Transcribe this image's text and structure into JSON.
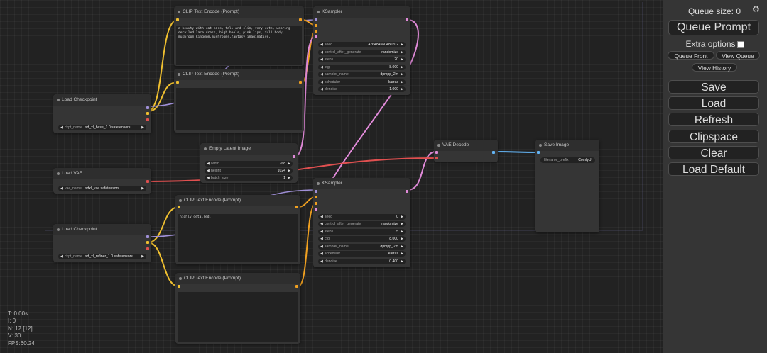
{
  "canvas": {
    "stats": [
      "T: 0.00s",
      "I: 0",
      "N: 12 [12]",
      "V: 30",
      "FPS:60.24"
    ],
    "nodes": {
      "clip1": {
        "title": "CLIP Text Encode (Prompt)",
        "text": "a beauty with cat ears, tall and slim, very cute, wearing detailed lace dress, high heels, pink lips, full body, mushroom kingdom,mushrooms,fantasy,imaginative,"
      },
      "clip2": {
        "title": "CLIP Text Encode (Prompt)",
        "text": ""
      },
      "ksampler1": {
        "title": "KSampler",
        "widgets": [
          {
            "label": "seed",
            "value": "476484560480702"
          },
          {
            "label": "control_after_generate",
            "value": "randomize"
          },
          {
            "label": "steps",
            "value": "20"
          },
          {
            "label": "cfg",
            "value": "8.000"
          },
          {
            "label": "sampler_name",
            "value": "dpmpp_2m"
          },
          {
            "label": "scheduler",
            "value": "karras"
          },
          {
            "label": "denoise",
            "value": "1.000"
          }
        ]
      },
      "ckpt1": {
        "title": "Load Checkpoint",
        "label": "ckpt_name",
        "value": "sd_xl_base_1.0.safetensors"
      },
      "latent": {
        "title": "Empty Latent Image",
        "widgets": [
          {
            "label": "width",
            "value": "768"
          },
          {
            "label": "height",
            "value": "1024"
          },
          {
            "label": "batch_size",
            "value": "1"
          }
        ]
      },
      "vaedecode": {
        "title": "VAE Decode"
      },
      "save": {
        "title": "Save Image",
        "label": "filename_prefix",
        "value": "ComfyUI"
      },
      "loadvae": {
        "title": "Load VAE",
        "label": "vae_name",
        "value": "sdxl_vae.safetensors"
      },
      "clip3": {
        "title": "CLIP Text Encode (Prompt)",
        "text": "highly detailed,"
      },
      "ksampler2": {
        "title": "KSampler",
        "widgets": [
          {
            "label": "seed",
            "value": "0"
          },
          {
            "label": "control_after_generate",
            "value": "randomize"
          },
          {
            "label": "steps",
            "value": "5"
          },
          {
            "label": "cfg",
            "value": "8.000"
          },
          {
            "label": "sampler_name",
            "value": "dpmpp_2m"
          },
          {
            "label": "scheduler",
            "value": "karras"
          },
          {
            "label": "denoise",
            "value": "0.400"
          }
        ]
      },
      "ckpt2": {
        "title": "Load Checkpoint",
        "label": "ckpt_name",
        "value": "sd_xl_refiner_1.0.safetensors"
      },
      "clip4": {
        "title": "CLIP Text Encode (Prompt)",
        "text": ""
      }
    },
    "link_colors": {
      "clip": "#f0c030",
      "model": "#a090d8",
      "conditioning": "#f0a020",
      "latent": "#e08ad8",
      "vae": "#e05050",
      "image": "#64b5f6"
    }
  },
  "menu": {
    "queue_size": "Queue size: 0",
    "queue_prompt": "Queue Prompt",
    "extra_options": "Extra options",
    "queue_front": "Queue Front",
    "view_queue": "View Queue",
    "view_history": "View History",
    "save": "Save",
    "load": "Load",
    "refresh": "Refresh",
    "clipspace": "Clipspace",
    "clear": "Clear",
    "load_default": "Load Default"
  }
}
